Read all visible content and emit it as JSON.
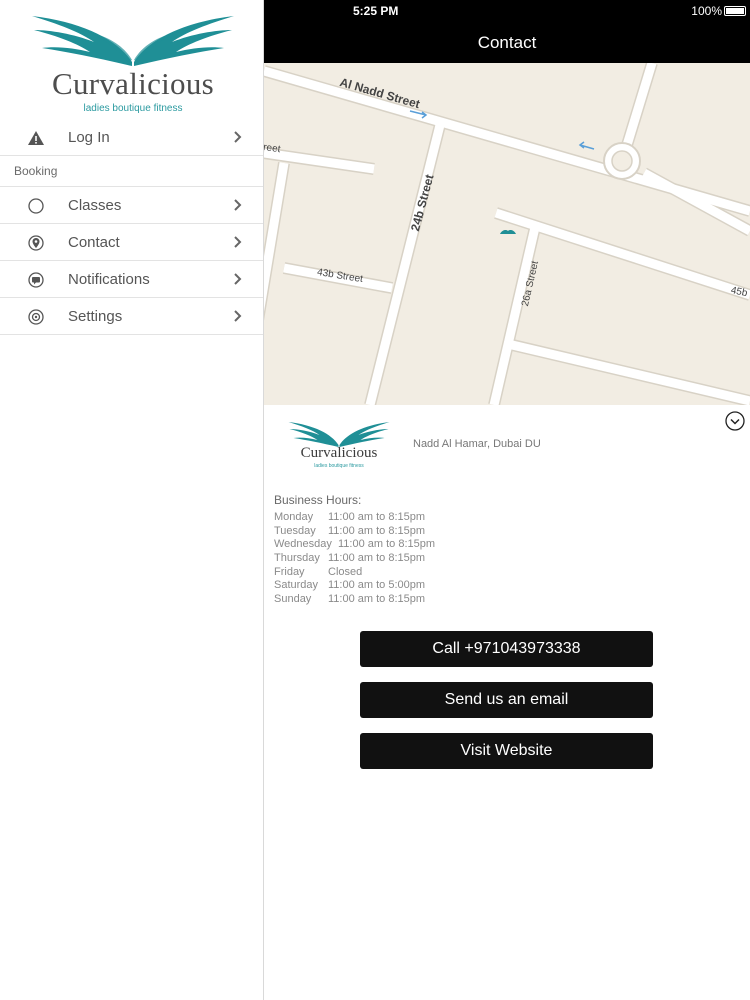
{
  "brand": {
    "name": "Curvalicious",
    "tagline": "ladies boutique fitness",
    "color": "#1f8f96"
  },
  "sidebar": {
    "items": [
      {
        "label": "Log In",
        "icon": "warning-icon"
      },
      {
        "label": "Classes",
        "icon": "circle-icon"
      },
      {
        "label": "Contact",
        "icon": "location-pin-icon"
      },
      {
        "label": "Notifications",
        "icon": "message-icon"
      },
      {
        "label": "Settings",
        "icon": "gear-icon"
      }
    ],
    "section_label": "Booking"
  },
  "status_bar": {
    "time": "5:25 PM",
    "battery": "100%"
  },
  "header": {
    "title": "Contact"
  },
  "map": {
    "streets": [
      "Al Nadd Street",
      "24b Street",
      "43b Street",
      "26a Street",
      "45b",
      "reet"
    ]
  },
  "contact": {
    "address": "Nadd Al Hamar, Dubai DU",
    "hours_title": "Business Hours:",
    "hours": [
      {
        "day": "Monday",
        "time": "11:00 am to 8:15pm"
      },
      {
        "day": "Tuesday",
        "time": "11:00 am to 8:15pm"
      },
      {
        "day": "Wednesday",
        "time": "11:00 am to 8:15pm"
      },
      {
        "day": "Thursday",
        "time": "11:00 am to 8:15pm"
      },
      {
        "day": "Friday",
        "time": "Closed"
      },
      {
        "day": "Saturday",
        "time": "11:00 am to 5:00pm"
      },
      {
        "day": "Sunday",
        "time": "11:00 am to 8:15pm"
      }
    ],
    "buttons": {
      "call": "Call +971043973338",
      "email": "Send us an email",
      "website": "Visit Website"
    }
  }
}
